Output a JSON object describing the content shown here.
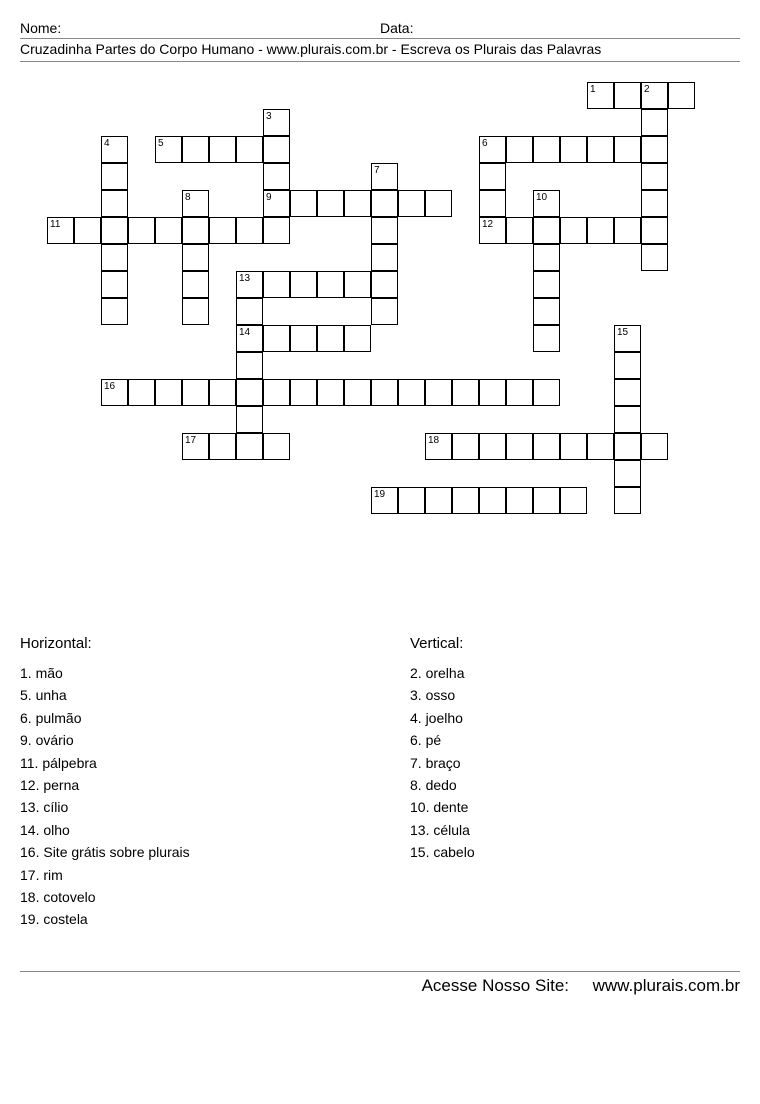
{
  "header": {
    "name_label": "Nome:",
    "date_label": "Data:"
  },
  "subtitle": "Cruzadinha Partes do Corpo Humano  -  www.plurais.com.br  -  Escreva os Plurais das Palavras",
  "clues": {
    "horizontal_title": "Horizontal:",
    "vertical_title": "Vertical:",
    "horizontal": [
      {
        "n": "1",
        "t": "mão"
      },
      {
        "n": "5",
        "t": "unha"
      },
      {
        "n": "6",
        "t": "pulmão"
      },
      {
        "n": "9",
        "t": "ovário"
      },
      {
        "n": "11",
        "t": "pálpebra"
      },
      {
        "n": "12",
        "t": "perna"
      },
      {
        "n": "13",
        "t": "cílio"
      },
      {
        "n": "14",
        "t": "olho"
      },
      {
        "n": "16",
        "t": "Site grátis sobre plurais"
      },
      {
        "n": "17",
        "t": "rim"
      },
      {
        "n": "18",
        "t": "cotovelo"
      },
      {
        "n": "19",
        "t": "costela"
      }
    ],
    "vertical": [
      {
        "n": "2",
        "t": "orelha"
      },
      {
        "n": "3",
        "t": "osso"
      },
      {
        "n": "4",
        "t": "joelho"
      },
      {
        "n": "6",
        "t": "pé"
      },
      {
        "n": "7",
        "t": "braço"
      },
      {
        "n": "8",
        "t": "dedo"
      },
      {
        "n": "10",
        "t": "dente"
      },
      {
        "n": "13",
        "t": "célula"
      },
      {
        "n": "15",
        "t": "cabelo"
      }
    ]
  },
  "footer": {
    "text": "Acesse Nosso Site:",
    "url": "www.plurais.com.br"
  },
  "grid": {
    "cell_size": 27,
    "words": [
      {
        "n": 1,
        "r": 0,
        "c": 21,
        "dir": "H",
        "len": 4
      },
      {
        "n": 2,
        "r": 0,
        "c": 23,
        "dir": "V",
        "len": 7
      },
      {
        "n": 3,
        "r": 1,
        "c": 9,
        "dir": "V",
        "len": 5
      },
      {
        "n": 4,
        "r": 2,
        "c": 3,
        "dir": "V",
        "len": 7
      },
      {
        "n": 5,
        "r": 2,
        "c": 5,
        "dir": "H",
        "len": 5
      },
      {
        "n": 6,
        "r": 2,
        "c": 17,
        "dir": "H",
        "len": 7
      },
      {
        "n": 6,
        "r": 2,
        "c": 17,
        "dir": "V",
        "len": 3
      },
      {
        "n": 7,
        "r": 3,
        "c": 13,
        "dir": "V",
        "len": 6
      },
      {
        "n": 8,
        "r": 4,
        "c": 6,
        "dir": "V",
        "len": 5
      },
      {
        "n": 9,
        "r": 4,
        "c": 9,
        "dir": "H",
        "len": 7
      },
      {
        "n": 10,
        "r": 4,
        "c": 19,
        "dir": "V",
        "len": 6
      },
      {
        "n": 11,
        "r": 5,
        "c": 1,
        "dir": "H",
        "len": 9
      },
      {
        "n": 12,
        "r": 5,
        "c": 17,
        "dir": "H",
        "len": 6
      },
      {
        "n": 13,
        "r": 7,
        "c": 8,
        "dir": "H",
        "len": 6
      },
      {
        "n": 13,
        "r": 7,
        "c": 8,
        "dir": "V",
        "len": 7
      },
      {
        "n": 14,
        "r": 9,
        "c": 8,
        "dir": "H",
        "len": 5
      },
      {
        "n": 15,
        "r": 9,
        "c": 22,
        "dir": "V",
        "len": 7
      },
      {
        "n": 16,
        "r": 11,
        "c": 3,
        "dir": "H",
        "len": 17
      },
      {
        "n": 17,
        "r": 13,
        "c": 6,
        "dir": "H",
        "len": 4
      },
      {
        "n": 18,
        "r": 13,
        "c": 15,
        "dir": "H",
        "len": 9
      },
      {
        "n": 19,
        "r": 15,
        "c": 13,
        "dir": "H",
        "len": 8
      }
    ]
  }
}
